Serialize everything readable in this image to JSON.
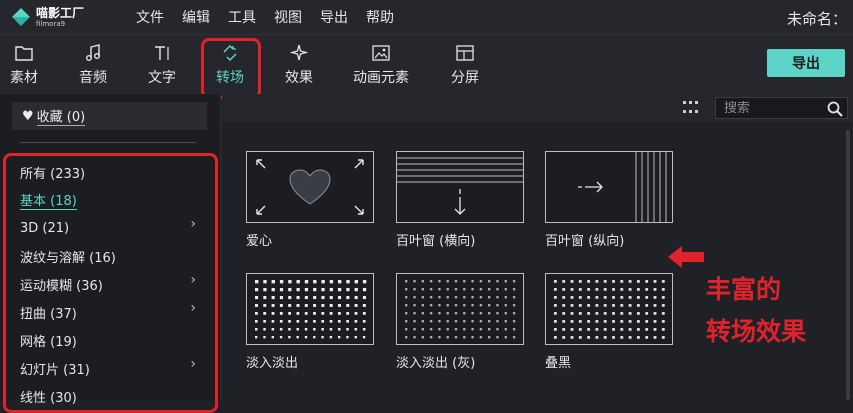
{
  "app": {
    "logo_cn": "喵影工厂",
    "logo_en": "filmora9",
    "doc_title": "未命名："
  },
  "menu": [
    "文件",
    "编辑",
    "工具",
    "视图",
    "导出",
    "帮助"
  ],
  "toolbar": {
    "tabs": [
      {
        "label": "素材",
        "icon": "folder-icon"
      },
      {
        "label": "音频",
        "icon": "music-note-icon"
      },
      {
        "label": "文字",
        "icon": "text-icon"
      },
      {
        "label": "转场",
        "icon": "transition-icon",
        "active": true
      },
      {
        "label": "效果",
        "icon": "sparkle-icon"
      },
      {
        "label": "动画元素",
        "icon": "image-icon"
      },
      {
        "label": "分屏",
        "icon": "split-screen-icon"
      }
    ],
    "export_label": "导出"
  },
  "sidebar": {
    "favorites": "收藏 (0)",
    "categories": [
      {
        "label": "所有 (233)",
        "chevron": false
      },
      {
        "label": "基本 (18)",
        "chevron": false,
        "active": true
      },
      {
        "label": "3D (21)",
        "chevron": true
      },
      {
        "label": "波纹与溶解 (16)",
        "chevron": false
      },
      {
        "label": "运动模糊 (36)",
        "chevron": true
      },
      {
        "label": "扭曲 (37)",
        "chevron": true
      },
      {
        "label": "网格 (19)",
        "chevron": false
      },
      {
        "label": "幻灯片 (31)",
        "chevron": true
      },
      {
        "label": "线性 (30)",
        "chevron": false
      }
    ]
  },
  "search": {
    "placeholder": "搜索"
  },
  "transitions": [
    {
      "label": "爱心"
    },
    {
      "label": "百叶窗 (横向)"
    },
    {
      "label": "百叶窗 (纵向)"
    },
    {
      "label": "淡入淡出"
    },
    {
      "label": "淡入淡出 (灰)"
    },
    {
      "label": "叠黑"
    }
  ],
  "annotation": {
    "line1": "丰富的",
    "line2": "转场效果"
  },
  "colors": {
    "accent": "#5ed3c8",
    "highlight": "#e0232b",
    "background": "#1f2126"
  }
}
